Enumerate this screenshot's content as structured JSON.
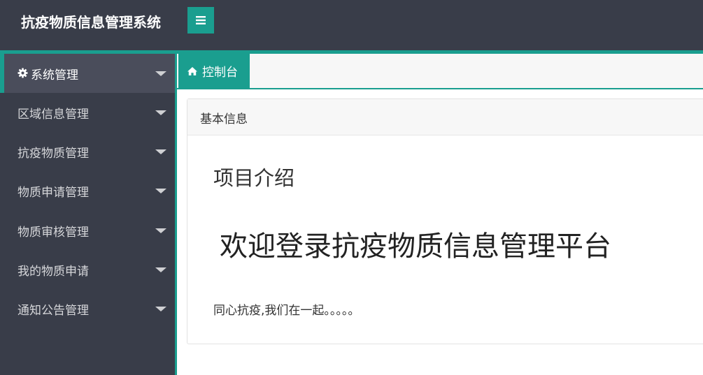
{
  "app": {
    "title": "抗疫物质信息管理系统"
  },
  "colors": {
    "topbar": "#393d49",
    "accent": "#1a9e8f",
    "sidebar": "#393d49",
    "sidebar_active": "#4a4d5b"
  },
  "sidebar": {
    "items": [
      {
        "label": "系统管理",
        "icon": "gear-icon",
        "active": true
      },
      {
        "label": "区域信息管理"
      },
      {
        "label": "抗疫物质管理"
      },
      {
        "label": "物质申请管理"
      },
      {
        "label": "物质审核管理"
      },
      {
        "label": "我的物质申请"
      },
      {
        "label": "通知公告管理"
      }
    ]
  },
  "tabs": [
    {
      "label": "控制台",
      "icon": "home-icon"
    }
  ],
  "card": {
    "header": "基本信息",
    "intro_title": "项目介绍",
    "welcome": "欢迎登录抗疫物质信息管理平台",
    "slogan": "同心抗疫,我们在一起。。。。。"
  }
}
